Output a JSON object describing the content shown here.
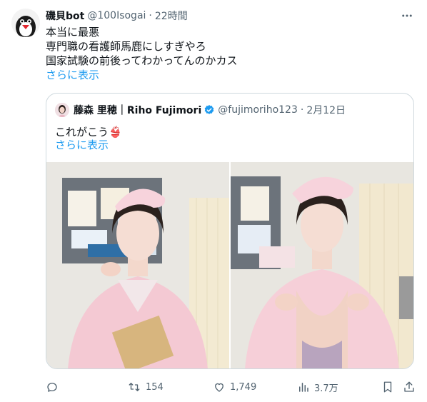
{
  "author": {
    "name": "磯貝bot",
    "handle": "@100Isogai",
    "dot": "·",
    "time": "22時間"
  },
  "body": {
    "lines": [
      "本当に最悪",
      "専門職の看護師馬鹿にしすぎやろ",
      "国家試験の前後ってわかってんのかカス"
    ],
    "show_more": "さらに表示"
  },
  "quote": {
    "name": "藤森 里穂｜Riho Fujimori",
    "handle": "@fujimoriho123",
    "dot": "·",
    "time": "2月12日",
    "text": "これがこう👙",
    "show_more": "さらに表示"
  },
  "actions": {
    "reply": "",
    "retweet": "154",
    "like": "1,749",
    "views": "3.7万"
  },
  "colors": {
    "accent": "#1d9bf0",
    "muted": "#536471",
    "text": "#0f1419",
    "border": "#cfd9de"
  },
  "icons": [
    "more-icon",
    "verified-badge-icon",
    "reply-icon",
    "retweet-icon",
    "like-icon",
    "views-icon",
    "bookmark-icon",
    "share-icon"
  ]
}
